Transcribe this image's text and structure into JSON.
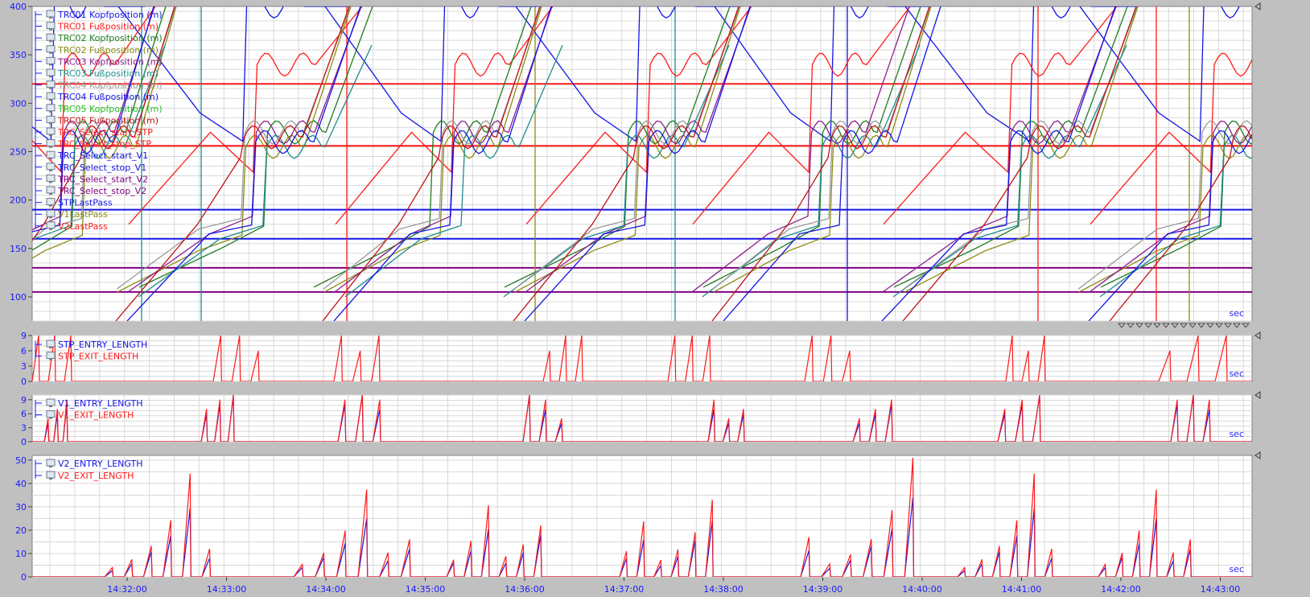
{
  "x_axis": {
    "ticks": [
      "14:32:00",
      "14:33:00",
      "14:34:00",
      "14:35:00",
      "14:36:00",
      "14:37:00",
      "14:38:00",
      "14:39:00",
      "14:40:00",
      "14:41:00",
      "14:42:00",
      "14:43:00"
    ],
    "unit": "sec"
  },
  "colors": {
    "blue": "#1414e6",
    "red": "#ff1a1a",
    "green": "#1e7a1e",
    "olive": "#8c8c14",
    "purple": "#8c1e8c",
    "teal": "#1e8c8c",
    "gray": "#9a9a9a",
    "lime": "#22c022",
    "darkred": "#c01414",
    "purpleline": "#800080"
  },
  "chart_data": [
    {
      "type": "line",
      "panel": "positions",
      "ylim": [
        75,
        400
      ],
      "yticks": [
        100,
        150,
        200,
        250,
        300,
        350,
        400
      ],
      "unit": "sec",
      "series": [
        {
          "name": "TRC01 Kopfposition (m)",
          "color": "blue",
          "x": [
            "14:31:10",
            "14:31:50",
            "14:32:20",
            "14:32:40",
            "14:33:00",
            "14:33:30",
            "14:34:00",
            "14:34:30",
            "14:35:00",
            "14:35:20",
            "14:36:30",
            "14:37:00",
            "14:37:40",
            "14:38:00"
          ],
          "values": [
            400,
            275,
            258,
            290,
            258,
            400,
            400,
            400,
            400,
            400,
            258,
            290,
            258,
            400
          ]
        },
        {
          "name": "TRC01 Fußposition (m)",
          "color": "red",
          "values": [
            175,
            150,
            230,
            270,
            225,
            340,
            400
          ]
        },
        {
          "name": "TRC02 Kopfposition (m)",
          "color": "green",
          "values": [
            110,
            125,
            140,
            150,
            175,
            270,
            285,
            260,
            400
          ]
        },
        {
          "name": "TRC02 Fußposition (m)",
          "color": "olive",
          "values": [
            105,
            120,
            135,
            148,
            165,
            255,
            270,
            245,
            400
          ]
        },
        {
          "name": "TRC03 Kopfposition (m)",
          "color": "purple",
          "values": [
            105,
            130,
            145,
            165,
            185,
            270,
            285,
            260,
            400
          ]
        },
        {
          "name": "TRC03 Fußposition (m)",
          "color": "teal",
          "values": [
            100,
            120,
            135,
            160,
            175,
            255,
            270,
            245,
            360
          ]
        },
        {
          "name": "TRC04 Kopfposition (m)",
          "color": "gray",
          "values": [
            108,
            130,
            145,
            170,
            182,
            270,
            285,
            260,
            400
          ]
        },
        {
          "name": "TRC04 Fußposition (m)",
          "color": "blue",
          "values": [
            75,
            120,
            150,
            165,
            175,
            260,
            275,
            250,
            400
          ]
        },
        {
          "name": "TRC05 Kopfposition (m)",
          "color": "lime",
          "values": []
        },
        {
          "name": "TRC05 Fußposition (m)",
          "color": "darkred",
          "values": [
            75,
            110,
            150,
            175,
            250,
            265,
            400
          ]
        },
        {
          "name": "TRC_Select_start_STP",
          "color": "red",
          "values": [
            320
          ]
        },
        {
          "name": "TRC_Select_stop_STP",
          "color": "red",
          "values": [
            256
          ]
        },
        {
          "name": "TRC_Select_start_V1",
          "color": "blue",
          "values": [
            190
          ]
        },
        {
          "name": "TRC_Select_stop_V1",
          "color": "blue",
          "values": [
            160
          ]
        },
        {
          "name": "TRC_Select_start_V2",
          "color": "purpleline",
          "values": [
            130
          ]
        },
        {
          "name": "TRC_Select_stop_V2",
          "color": "purpleline",
          "values": [
            105
          ]
        },
        {
          "name": "STPLastPass",
          "color": "blue",
          "values": []
        },
        {
          "name": "V1LastPass",
          "color": "olive",
          "values": []
        },
        {
          "name": "V2LastPass",
          "color": "red",
          "values": []
        }
      ]
    },
    {
      "type": "line",
      "panel": "STP",
      "ylim": [
        0,
        9
      ],
      "yticks": [
        0,
        3,
        6,
        9
      ],
      "unit": "sec",
      "series": [
        {
          "name": "STP_ENTRY_LENGTH",
          "color": "blue",
          "values": []
        },
        {
          "name": "STP_EXIT_LENGTH",
          "color": "red",
          "values": [
            0,
            9,
            0,
            9,
            0,
            9,
            0,
            6,
            0,
            9,
            0,
            9,
            0,
            9,
            0,
            6,
            0,
            9,
            0
          ]
        }
      ]
    },
    {
      "type": "line",
      "panel": "V1",
      "ylim": [
        0,
        10
      ],
      "yticks": [
        0,
        3,
        6,
        9
      ],
      "unit": "sec",
      "series": [
        {
          "name": "V1_ENTRY_LENGTH",
          "color": "blue",
          "values": [
            0,
            4,
            0,
            6,
            0,
            8,
            0,
            10,
            0,
            7,
            0
          ]
        },
        {
          "name": "V1_EXIT_LENGTH",
          "color": "red",
          "values": [
            0,
            5,
            0,
            7,
            0,
            9,
            0,
            10,
            0,
            9,
            0
          ]
        }
      ]
    },
    {
      "type": "line",
      "panel": "V2",
      "ylim": [
        0,
        52
      ],
      "yticks": [
        0,
        10,
        20,
        30,
        40,
        50
      ],
      "unit": "sec",
      "series": [
        {
          "name": "V2_ENTRY_LENGTH",
          "color": "blue",
          "values": [
            0,
            8,
            0,
            12,
            0,
            18,
            0,
            24,
            0,
            34,
            0
          ]
        },
        {
          "name": "V2_EXIT_LENGTH",
          "color": "red",
          "values": [
            0,
            12,
            0,
            16,
            0,
            22,
            0,
            33,
            0,
            51,
            0
          ]
        }
      ]
    }
  ]
}
